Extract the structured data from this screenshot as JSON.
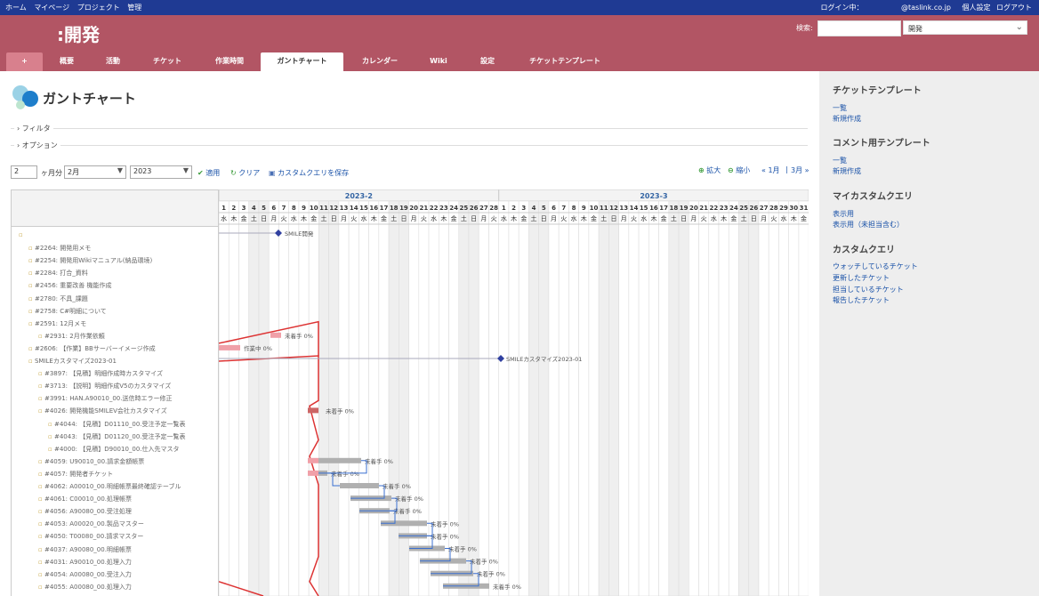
{
  "topbar": {
    "nav": [
      "ホーム",
      "マイページ",
      "プロジェクト",
      "管理"
    ],
    "login_label": "ログイン中：",
    "login_user": "@taslink.co.jp",
    "personal_settings": "個人設定",
    "logout": "ログアウト"
  },
  "header": {
    "project_title": ":開発",
    "search_label": "検索:",
    "search_value": "",
    "project_select": "開発"
  },
  "tabs": [
    "+",
    "概要",
    "活動",
    "チケット",
    "作業時間",
    "ガントチャート",
    "カレンダー",
    "Wiki",
    "設定",
    "チケットテンプレート"
  ],
  "active_tab": "ガントチャート",
  "page": {
    "title": "ガントチャート",
    "filter_label": "フィルタ",
    "option_label": "オプション"
  },
  "controls": {
    "months_value": "2",
    "months_label": "ヶ月分",
    "month_select": "2月",
    "year_select": "2023",
    "apply": "適用",
    "clear": "クリア",
    "save_query": "カスタムクエリを保存",
    "zoom_in": "拡大",
    "zoom_out": "縮小",
    "prev_month": "« 1月",
    "separator": "|",
    "next_month": "3月 »"
  },
  "gantt": {
    "months": [
      {
        "label": "2023-2",
        "days": 28
      },
      {
        "label": "2023-3",
        "days": 31
      }
    ],
    "days": [
      1,
      2,
      3,
      4,
      5,
      6,
      7,
      8,
      9,
      10,
      11,
      12,
      13,
      14,
      15,
      16,
      17,
      18,
      19,
      20,
      21,
      22,
      23,
      24,
      25,
      26,
      27,
      28,
      1,
      2,
      3,
      4,
      5,
      6,
      7,
      8,
      9,
      10,
      11,
      12,
      13,
      14,
      15,
      16,
      17,
      18,
      19,
      20,
      21,
      22,
      23,
      24,
      25,
      26,
      27,
      28,
      29,
      30,
      31
    ],
    "weekdays": [
      "水",
      "木",
      "金",
      "土",
      "日",
      "月",
      "火",
      "水",
      "木",
      "金",
      "土",
      "日",
      "月",
      "火",
      "水",
      "木",
      "金",
      "土",
      "日",
      "月",
      "火",
      "水",
      "木",
      "金",
      "土",
      "日",
      "月",
      "火",
      "水",
      "木",
      "金",
      "土",
      "日",
      "月",
      "火",
      "水",
      "木",
      "金",
      "土",
      "日",
      "月",
      "火",
      "水",
      "木",
      "金",
      "土",
      "日",
      "月",
      "火",
      "水",
      "木",
      "金",
      "土",
      "日",
      "月",
      "火",
      "水",
      "木",
      "金"
    ],
    "subjects": [
      {
        "text": "",
        "indent": 0
      },
      {
        "text": "#2264: 開発用メモ",
        "indent": 1
      },
      {
        "text": "#2254: 開発用Wikiマニュアル(納品環境)",
        "indent": 1
      },
      {
        "text": "#2284: 打合_資料",
        "indent": 1
      },
      {
        "text": "#2456: 重要改善 機能作成",
        "indent": 1
      },
      {
        "text": "#2780: 不具_課題",
        "indent": 1
      },
      {
        "text": "#2758: C#明細について",
        "indent": 1
      },
      {
        "text": "#2591: 12月メモ",
        "indent": 1
      },
      {
        "text": "#2931: 2月作業依頼",
        "indent": 2
      },
      {
        "text": "#2606: 【作業】BBサーバーイメージ作成",
        "indent": 1
      },
      {
        "text": "SMILEカスタマイズ2023-01",
        "indent": 1
      },
      {
        "text": "#3897: 【見積】明細作成時カスタマイズ",
        "indent": 2
      },
      {
        "text": "#3713: 【説明】明細作成V5のカスタマイズ",
        "indent": 2
      },
      {
        "text": "#3991: HAN.A90010_00.送信時エラー修正",
        "indent": 2
      },
      {
        "text": "#4026: 開発機能SMILEV会社カスタマイズ",
        "indent": 2
      },
      {
        "text": "#4044: 【見積】D01110_00.受注予定一覧表",
        "indent": 3
      },
      {
        "text": "#4043: 【見積】D01120_00.受注予定一覧表",
        "indent": 3
      },
      {
        "text": "#4000: 【見積】D90010_00.仕入先マスタ",
        "indent": 3
      },
      {
        "text": "#4059: U90010_00.請求金額帳票",
        "indent": 2
      },
      {
        "text": "#4057: 開発者チケット",
        "indent": 2
      },
      {
        "text": "#4062: A00010_00.明細帳票最終確認テーブル",
        "indent": 2
      },
      {
        "text": "#4061: C00010_00.処理帳票",
        "indent": 2
      },
      {
        "text": "#4056: A90080_00.受注処理",
        "indent": 2
      },
      {
        "text": "#4053: A00020_00.製品マスター",
        "indent": 2
      },
      {
        "text": "#4050: T00080_00.請求マスター",
        "indent": 2
      },
      {
        "text": "#4037: A90080_00.明細帳票",
        "indent": 2
      },
      {
        "text": "#4031: A90010_00.処理入力",
        "indent": 2
      },
      {
        "text": "#4054: A00080_00.受注入力",
        "indent": 2
      },
      {
        "text": "#4055: A00080_00.処理入力",
        "indent": 2
      }
    ],
    "labels": {
      "milestone1": "SMILE開発",
      "milestone2": "SMILEカスタマイズ2023-01",
      "working": "作業中 0%",
      "not_started": "未着手 0%"
    }
  }
}
